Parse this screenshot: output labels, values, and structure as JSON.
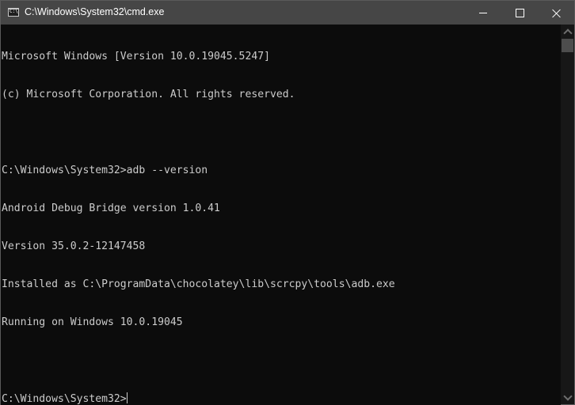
{
  "window": {
    "title": "C:\\Windows\\System32\\cmd.exe",
    "icon": "cmd-console-icon",
    "icon_text": "C:\\_",
    "controls": {
      "minimize": "minimize-icon",
      "maximize": "maximize-icon",
      "close": "close-icon"
    }
  },
  "console": {
    "lines": [
      "Microsoft Windows [Version 10.0.19045.5247]",
      "(c) Microsoft Corporation. All rights reserved.",
      "",
      "C:\\Windows\\System32>adb --version",
      "Android Debug Bridge version 1.0.41",
      "Version 35.0.2-12147458",
      "Installed as C:\\ProgramData\\chocolatey\\lib\\scrcpy\\tools\\adb.exe",
      "Running on Windows 10.0.19045",
      ""
    ],
    "prompt": "C:\\Windows\\System32>",
    "input": ""
  },
  "colors": {
    "titlebar": "#464646",
    "console_bg": "#0c0c0c",
    "console_fg": "#cccccc"
  }
}
